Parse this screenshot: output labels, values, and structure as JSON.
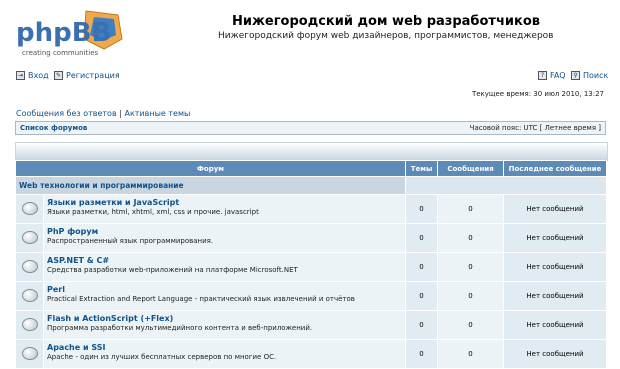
{
  "header": {
    "logo_text": "phpBB",
    "logo_tagline": "creating communities",
    "site_title": "Нижегородский дом web разработчиков",
    "site_description": "Нижегородский форум web дизайнеров, программистов, менеджеров"
  },
  "nav": {
    "login": "Вход",
    "register": "Регистрация",
    "faq": "FAQ",
    "search": "Поиск"
  },
  "current_time": "Текущее время: 30 июл 2010, 13:27",
  "quicklinks": {
    "unanswered": "Сообщения без ответов",
    "separator": "|",
    "active": "Активные темы"
  },
  "breadcrumb": {
    "forum_index": "Список форумов",
    "timezone": "Часовой пояс: UTC [ Летнее время ]"
  },
  "table": {
    "headers": [
      "Форум",
      "Темы",
      "Сообщения",
      "Последнее сообщение"
    ],
    "category": "Web технологии и программирование",
    "forums": [
      {
        "name": "Языки разметки и JavaScript",
        "desc": "Языки разметки, html, xhtml, xml, css и прочие. javascript",
        "topics": "0",
        "posts": "0",
        "last": "Нет сообщений"
      },
      {
        "name": "PhP форум",
        "desc": "Распространенный язык программирования.",
        "topics": "0",
        "posts": "0",
        "last": "Нет сообщений"
      },
      {
        "name": "ASP.NET & C#",
        "desc": "Средства разработки web-приложений на платформе Microsoft.NET",
        "topics": "0",
        "posts": "0",
        "last": "Нет сообщений"
      },
      {
        "name": "Perl",
        "desc": "Practical Extraction and Report Language - практический язык извлечений и отчётов",
        "topics": "0",
        "posts": "0",
        "last": "Нет сообщений"
      },
      {
        "name": "Flash и ActionScript (+Flex)",
        "desc": "Программа разработки мультимедийного контента и веб-приложений.",
        "topics": "0",
        "posts": "0",
        "last": "Нет сообщений"
      },
      {
        "name": "Apache и SSI",
        "desc": "Apache - один из лучших бесплатных серверов по многие ОС.",
        "topics": "0",
        "posts": "0",
        "last": "Нет сообщений"
      }
    ]
  },
  "colors": {
    "header_bg": "#5b8bb6",
    "link": "#105289",
    "row_light": "#ecf3f7",
    "row_dark": "#e1ebf2"
  }
}
